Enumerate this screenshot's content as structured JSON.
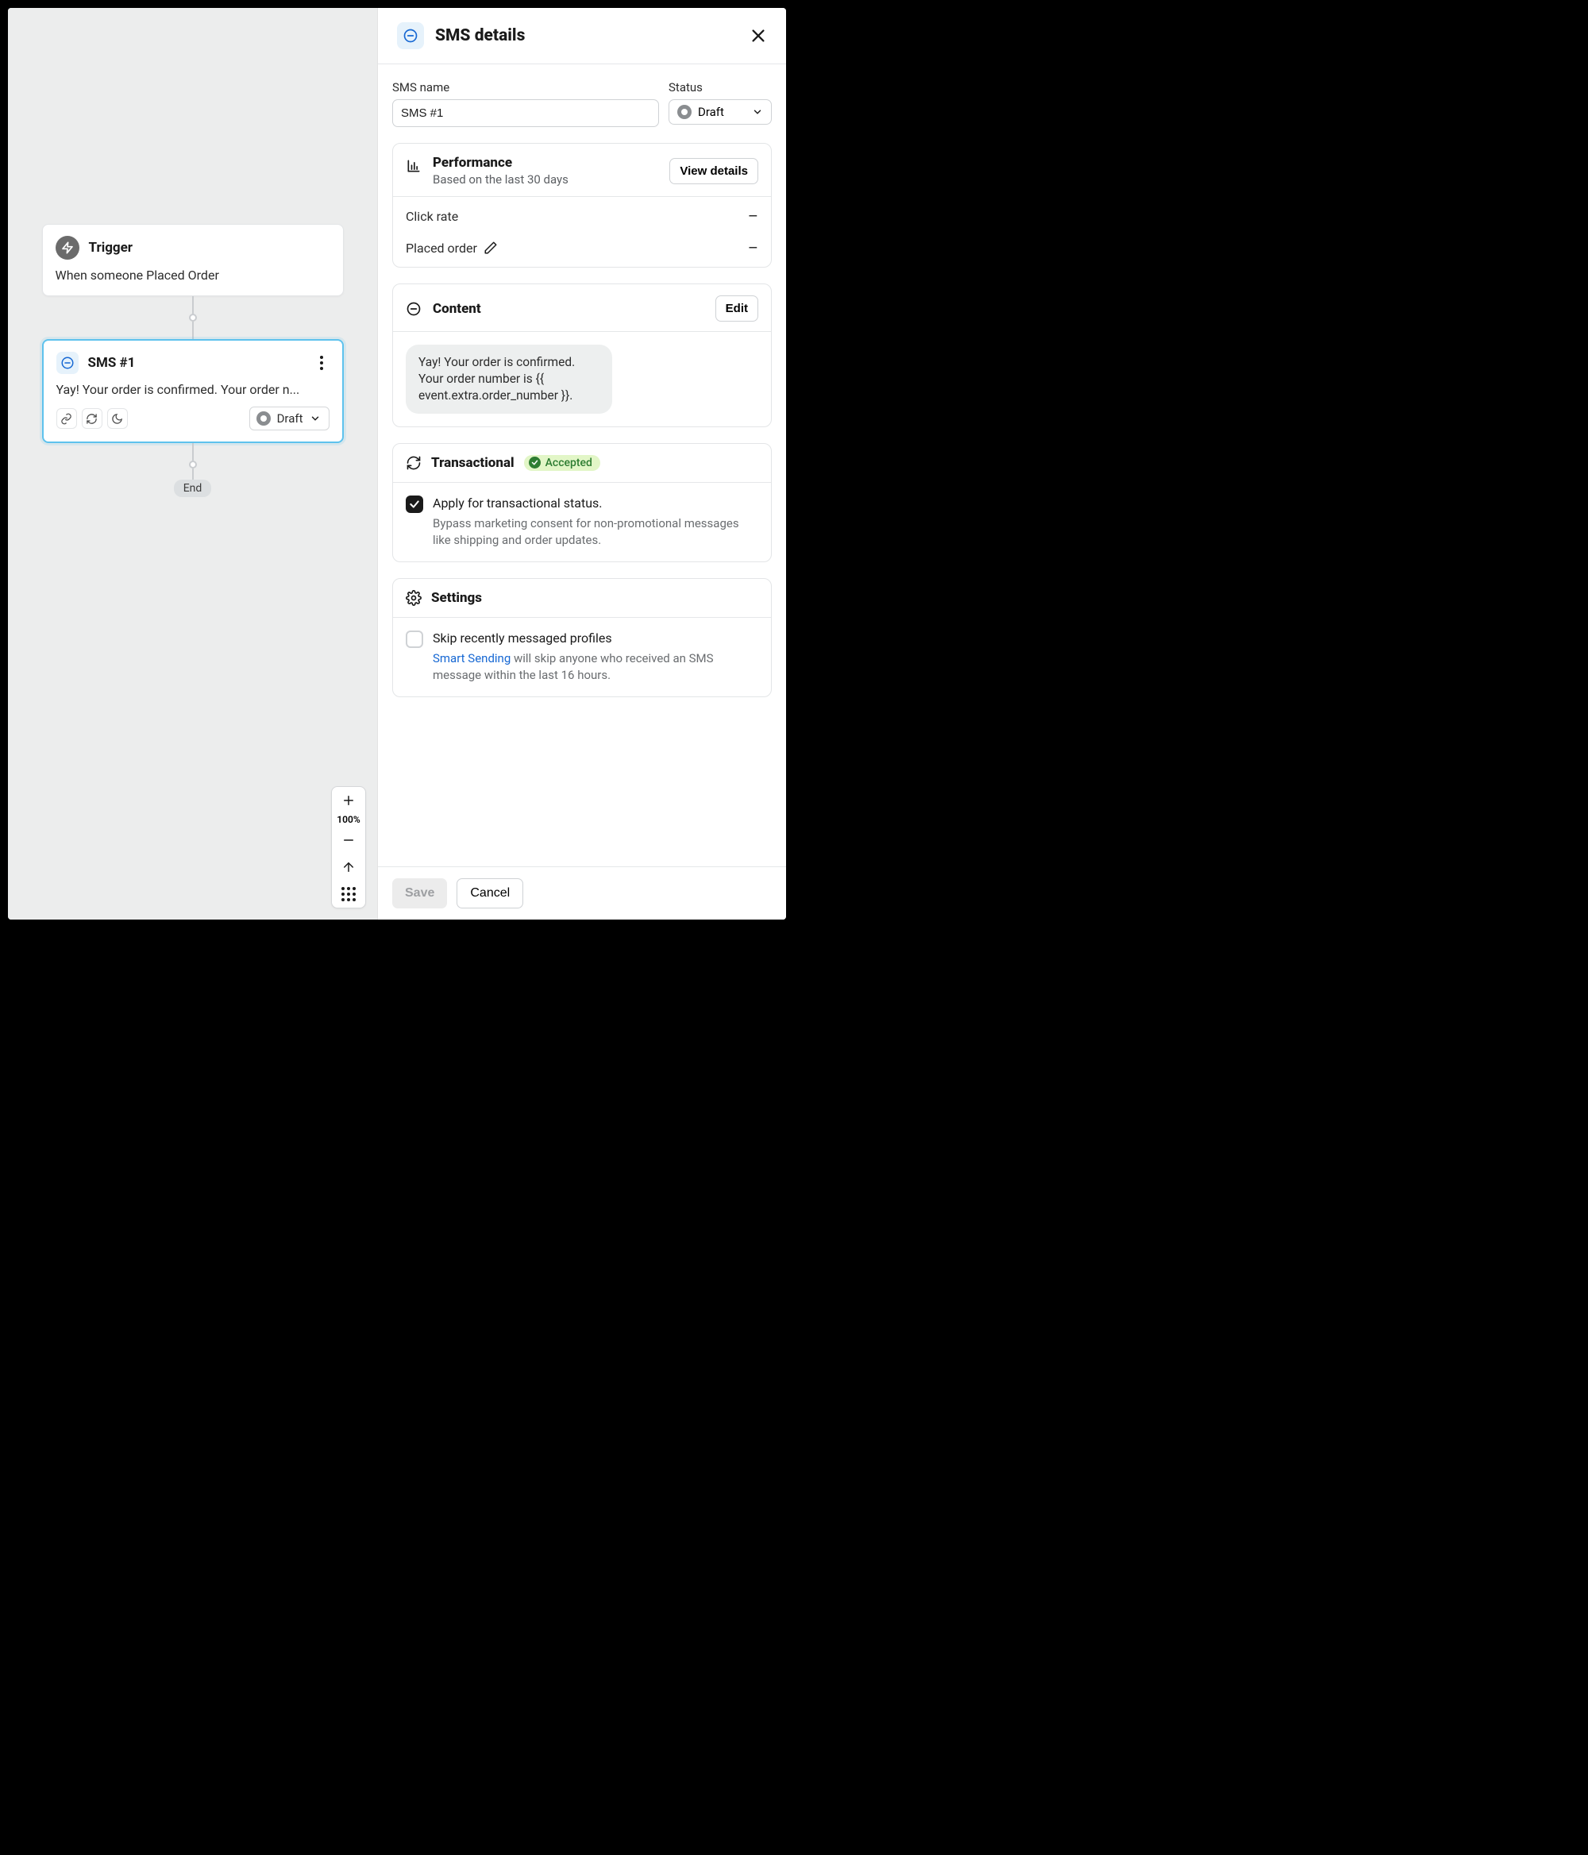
{
  "canvas": {
    "trigger": {
      "title": "Trigger",
      "description": "When someone Placed Order"
    },
    "sms_node": {
      "title": "SMS #1",
      "preview": "Yay! Your order is confirmed. Your order n...",
      "status": "Draft"
    },
    "end_label": "End",
    "zoom_level": "100%"
  },
  "panel": {
    "title": "SMS details",
    "name_label": "SMS name",
    "name_value": "SMS #1",
    "status_label": "Status",
    "status_value": "Draft",
    "performance": {
      "title": "Performance",
      "subtitle": "Based on the last 30 days",
      "view_button": "View details",
      "metrics": {
        "click_rate": {
          "label": "Click rate",
          "value": "–"
        },
        "placed_order": {
          "label": "Placed order",
          "value": "–"
        }
      }
    },
    "content": {
      "title": "Content",
      "edit_button": "Edit",
      "message": "Yay! Your order is confirmed. Your order number is {{ event.extra.order_number }}."
    },
    "transactional": {
      "title": "Transactional",
      "badge": "Accepted",
      "checkbox_label": "Apply for transactional status.",
      "help_text": "Bypass marketing consent for non-promotional messages like shipping and order updates."
    },
    "settings": {
      "title": "Settings",
      "skip": {
        "label": "Skip recently messaged profiles",
        "link_text": "Smart Sending",
        "rest_text": " will skip anyone who received an SMS message within the last 16 hours."
      }
    },
    "footer": {
      "save": "Save",
      "cancel": "Cancel"
    }
  }
}
